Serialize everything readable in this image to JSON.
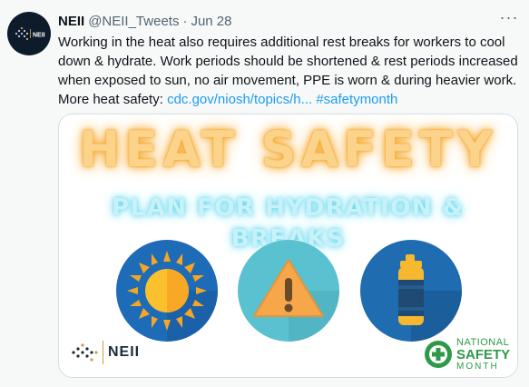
{
  "tweet": {
    "author_name": "NEII",
    "author_handle": "@NEII_Tweets",
    "separator": "·",
    "date": "Jun 28",
    "more_label": "···",
    "text": "Working in the heat also requires additional rest breaks for workers to cool down & hydrate. Work periods should be shortened & rest periods increased when exposed to sun, no air movement, PPE is worn & during heavier work. More heat safety: ",
    "link_text": "cdc.gov/niosh/topics/h...",
    "hashtag": "#safetymonth"
  },
  "card": {
    "title": "HEAT SAFETY",
    "subtitle": "PLAN FOR HYDRATION & BREAKS",
    "icons": [
      "sun-icon",
      "warning-icon",
      "water-bottle-icon"
    ],
    "logo_left": "NEII",
    "logo_right": {
      "line1": "NATIONAL",
      "line2": "SAFETY",
      "line3": "MONTH"
    }
  },
  "colors": {
    "link": "#1d9bf0",
    "title_glow": "#f6a62c",
    "subtitle_glow": "#5bd6f0",
    "sun_bg": "#1e6bb8",
    "warning_bg": "#5ac1d0",
    "bottle_bg": "#1f6cb0",
    "nsm_green": "#2e9a48"
  }
}
